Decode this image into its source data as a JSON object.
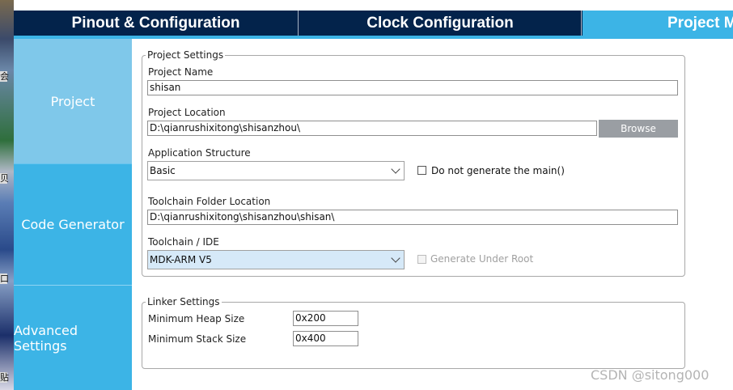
{
  "tabs": [
    {
      "label": "Pinout & Configuration"
    },
    {
      "label": "Clock Configuration"
    },
    {
      "label": "Project M"
    }
  ],
  "nav": {
    "items": [
      {
        "label": "Project"
      },
      {
        "label": "Code Generator"
      },
      {
        "label": "Advanced Settings"
      }
    ]
  },
  "project_settings": {
    "legend": "Project Settings",
    "project_name_label": "Project Name",
    "project_name_value": "shisan",
    "project_location_label": "Project Location",
    "project_location_value": "D:\\qianrushixitong\\shisanzhou\\",
    "browse_label": "Browse",
    "app_structure_label": "Application Structure",
    "app_structure_value": "Basic",
    "no_main_label": "Do not generate the main()",
    "toolchain_folder_label": "Toolchain Folder Location",
    "toolchain_folder_value": "D:\\qianrushixitong\\shisanzhou\\shisan\\",
    "toolchain_ide_label": "Toolchain / IDE",
    "toolchain_ide_value": "MDK-ARM V5",
    "generate_under_root_label": "Generate Under Root"
  },
  "linker_settings": {
    "legend": "Linker Settings",
    "heap_label": "Minimum Heap Size",
    "heap_value": "0x200",
    "stack_label": "Minimum Stack Size",
    "stack_value": "0x400"
  },
  "watermark": "CSDN @sitong000",
  "colors": {
    "tab_dark": "#03234b",
    "tab_active": "#3cb4e6",
    "nav_selected": "#7fc8ea",
    "nav_default": "#3cb4e6",
    "browse_button": "#9a9ea3"
  }
}
